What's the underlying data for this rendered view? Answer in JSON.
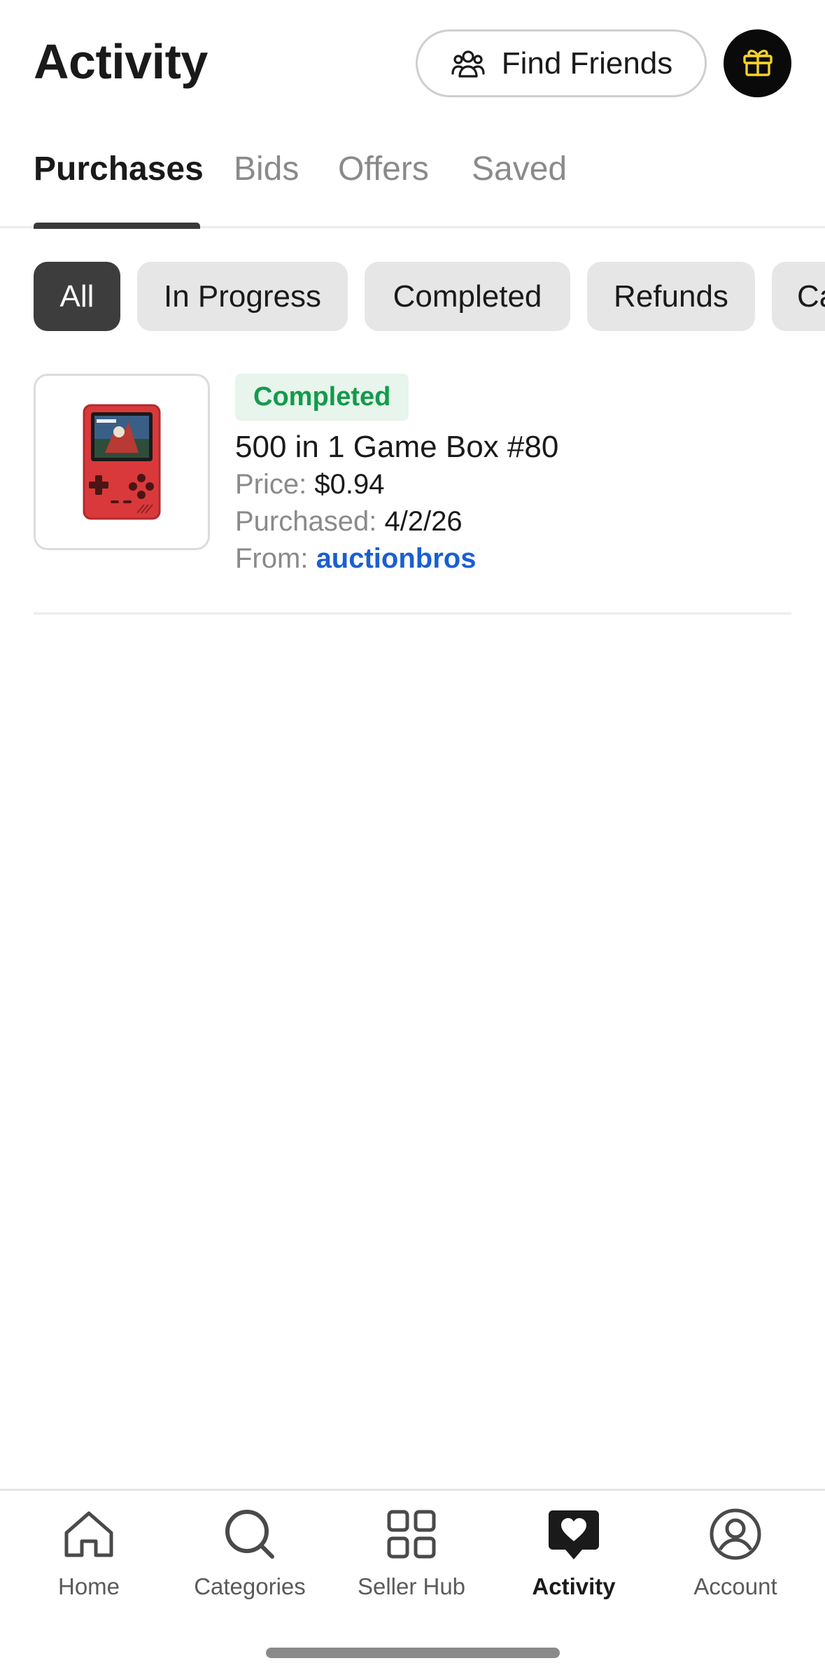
{
  "header": {
    "title": "Activity",
    "find_friends_label": "Find Friends",
    "find_friends_icon": "people-icon",
    "gift_icon": "gift-icon",
    "gift_color": "#f3d22b"
  },
  "tabs": [
    {
      "label": "Purchases",
      "active": true
    },
    {
      "label": "Bids",
      "active": false
    },
    {
      "label": "Offers",
      "active": false
    },
    {
      "label": "Saved",
      "active": false
    }
  ],
  "filters": [
    {
      "label": "All",
      "selected": true
    },
    {
      "label": "In Progress",
      "selected": false
    },
    {
      "label": "Completed",
      "selected": false
    },
    {
      "label": "Refunds",
      "selected": false
    },
    {
      "label": "Ca",
      "selected": false
    }
  ],
  "purchases": [
    {
      "status": "Completed",
      "status_color": "#139a4b",
      "title": "500 in 1 Game Box #80",
      "price_label": "Price:",
      "price": "$0.94",
      "purchased_label": "Purchased:",
      "purchased_date": "4/2/26",
      "from_label": "From:",
      "seller": "auctionbros",
      "image_icon": "handheld-game-console-image"
    }
  ],
  "bottom_nav": [
    {
      "label": "Home",
      "icon": "home-icon",
      "active": false
    },
    {
      "label": "Categories",
      "icon": "search-icon",
      "active": false
    },
    {
      "label": "Seller Hub",
      "icon": "grid-icon",
      "active": false
    },
    {
      "label": "Activity",
      "icon": "heart-chat-icon",
      "active": true
    },
    {
      "label": "Account",
      "icon": "account-icon",
      "active": false
    }
  ],
  "colors": {
    "accent_link": "#1a5fd0",
    "chip_selected": "#3d3d3d",
    "chip_default": "#e6e6e6"
  }
}
